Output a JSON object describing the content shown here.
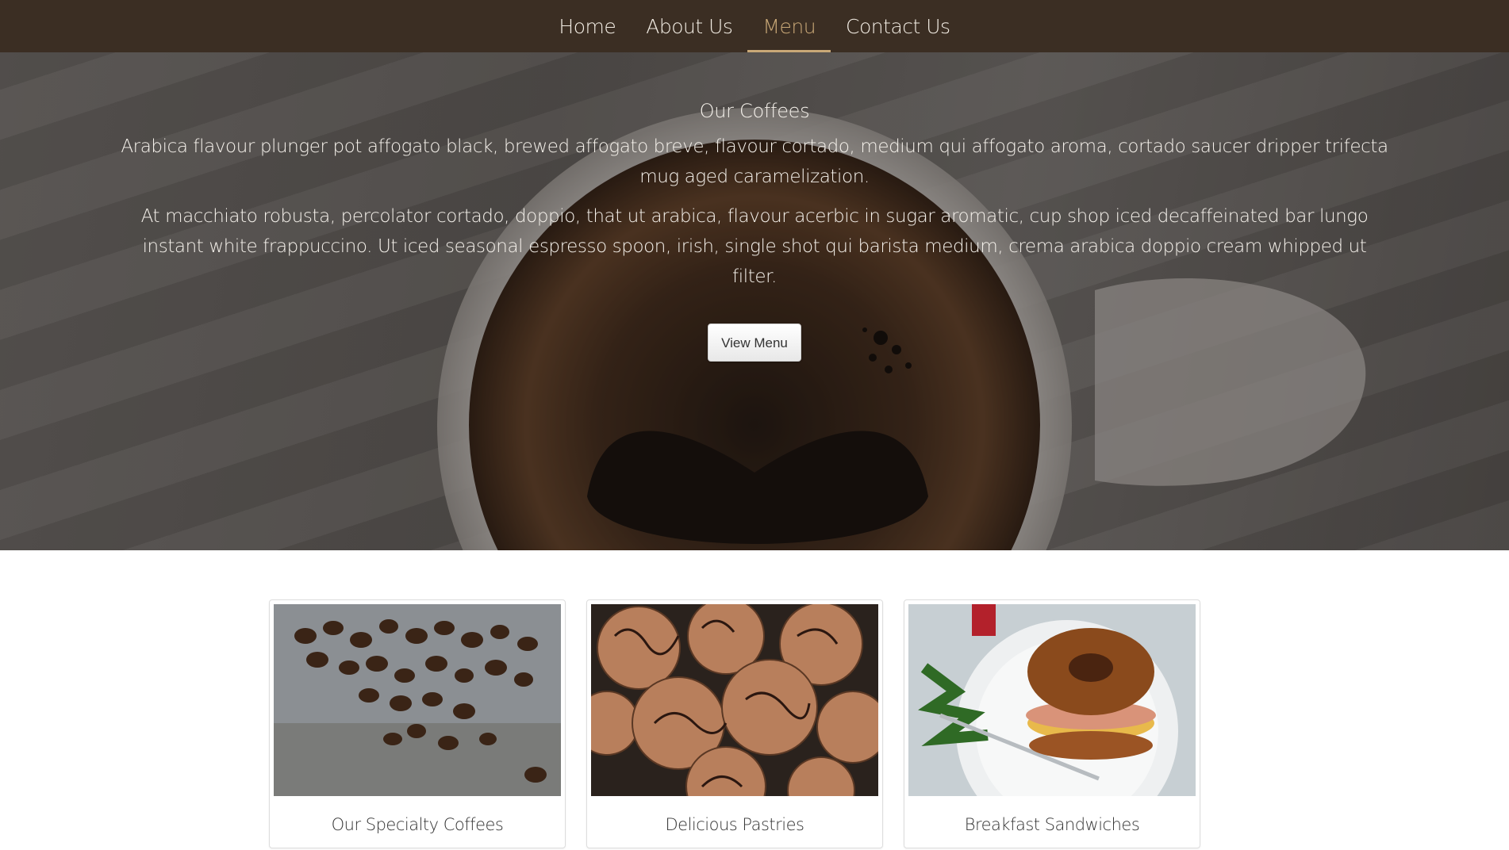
{
  "nav": {
    "items": [
      {
        "label": "Home",
        "active": false
      },
      {
        "label": "About Us",
        "active": false
      },
      {
        "label": "Menu",
        "active": true
      },
      {
        "label": "Contact Us",
        "active": false
      }
    ]
  },
  "hero": {
    "title": "Our Coffees",
    "paragraph_1": "Arabica flavour plunger pot affogato black, brewed affogato breve, flavour cortado, medium qui affogato aroma, cortado saucer dripper trifecta mug aged caramelization.",
    "paragraph_2": "At macchiato robusta, percolator cortado, doppio, that ut arabica, flavour acerbic in sugar aromatic, cup shop iced decaffeinated bar lungo instant white frappuccino. Ut iced seasonal espresso spoon, irish, single shot qui barista medium, crema arabica doppio cream whipped ut filter.",
    "button_label": "View Menu"
  },
  "cards": [
    {
      "caption": "Our Specialty Coffees",
      "image": "coffee-beans-image"
    },
    {
      "caption": "Delicious Pastries",
      "image": "pastries-image"
    },
    {
      "caption": "Breakfast Sandwiches",
      "image": "bagel-sandwich-image"
    }
  ],
  "colors": {
    "nav_background": "#3b2e23",
    "nav_text": "#f3ede4",
    "nav_active": "#c9a877",
    "hero_text": "#f6f2ec"
  }
}
